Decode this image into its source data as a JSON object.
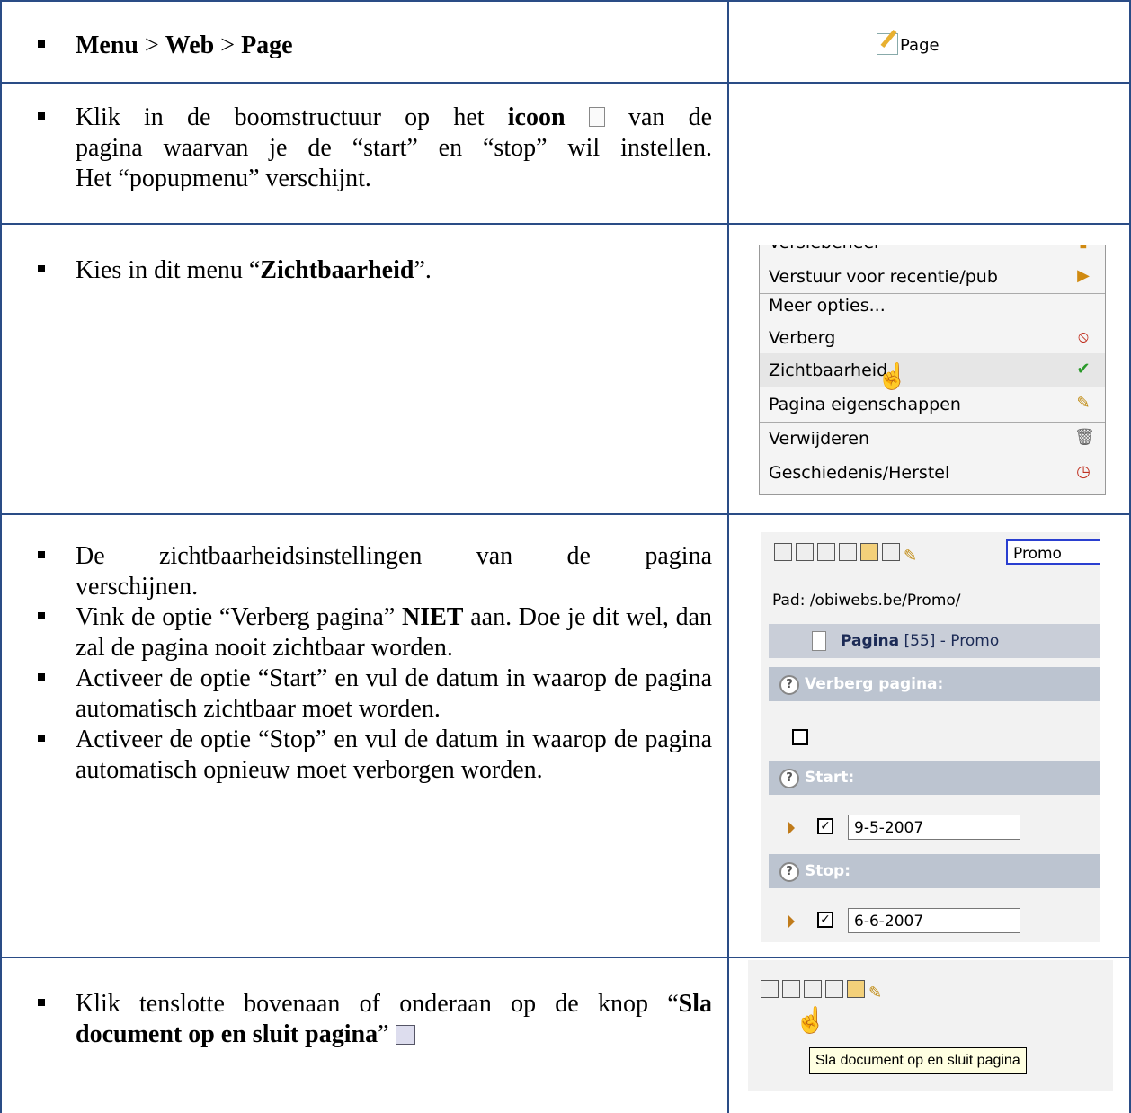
{
  "row1": {
    "menu": "Menu",
    "sep1": " > ",
    "web": "Web",
    "sep2": " > ",
    "page": "Page",
    "icon_label": "Page"
  },
  "row2": {
    "line1_a": "Klik in de boomstructuur op het ",
    "line1_b": "icoon",
    "line1_c": " van de",
    "line2": "pagina waarvan je de “start” en “stop” wil instellen.",
    "line3": "Het “popupmenu” verschijnt."
  },
  "row3": {
    "text_a": "Kies in dit menu “",
    "text_b": "Zichtbaarheid",
    "text_c": "”.",
    "menu_items": [
      "Verstuur voor recentie/pub",
      "Meer opties...",
      "Verberg",
      "Zichtbaarheid",
      "Pagina eigenschappen",
      "Verwijderen",
      "Geschiedenis/Herstel"
    ],
    "cut_item": "Versiebeheer"
  },
  "row4": {
    "b1_l1": "De  zichtbaarheidsinstellingen  van  de  pagina",
    "b1_l2": "verschijnen.",
    "b2_a": "Vink de optie “Verberg pagina” ",
    "b2_b": "NIET",
    "b2_c": " aan. Doe je dit wel, dan zal de pagina nooit zichtbaar worden.",
    "b3": "Activeer de optie “Start” en vul de datum in waarop de pagina automatisch zichtbaar moet worden.",
    "b4": "Activeer de optie “Stop” en vul de datum in waarop de pagina automatisch opnieuw moet verborgen worden.",
    "panel": {
      "title_field": "Promo",
      "path": "Pad: /obiwebs.be/Promo/",
      "record_a": "Pagina",
      "record_b": " [55] - Promo",
      "hide_label": "Verberg pagina:",
      "start_label": "Start:",
      "start_date": "9-5-2007",
      "stop_label": "Stop:",
      "stop_date": "6-6-2007"
    }
  },
  "row5": {
    "line1_a": "Klik tenslotte bovenaan of onderaan op de knop “",
    "line1_b": "Sla",
    "line2_b": "document op en sluit pagina",
    "line2_c": "”",
    "tooltip": "Sla document op en sluit pagina"
  }
}
